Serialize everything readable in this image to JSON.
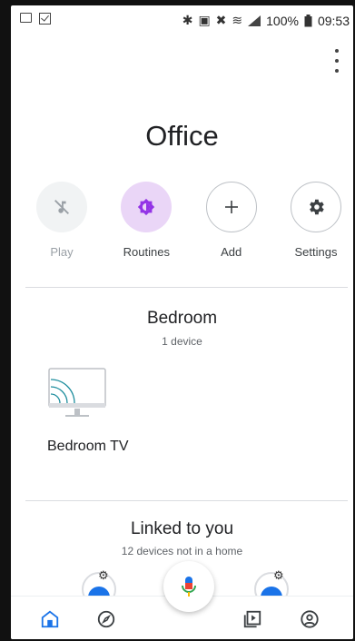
{
  "status_bar": {
    "battery": "100%",
    "time": "09:53",
    "icons": [
      "image-icon",
      "check-box-icon",
      "bluetooth-icon",
      "nfc-icon",
      "mute-icon",
      "wifi-icon",
      "signal-icon",
      "battery-icon"
    ]
  },
  "home": {
    "title": "Office"
  },
  "actions": [
    {
      "label": "Play",
      "icon": "play-disabled-icon",
      "state": "disabled"
    },
    {
      "label": "Routines",
      "icon": "routines-icon"
    },
    {
      "label": "Add",
      "icon": "plus-icon"
    },
    {
      "label": "Settings",
      "icon": "gear-icon"
    }
  ],
  "room": {
    "title": "Bedroom",
    "subtitle": "1 device",
    "device_name": "Bedroom TV",
    "device_icon": "cast-tv-icon"
  },
  "linked": {
    "title": "Linked to you",
    "subtitle": "12 devices not in a home"
  },
  "bottom_nav": [
    "home-icon",
    "explore-icon",
    "media-icon",
    "account-icon"
  ],
  "colors": {
    "accent": "#1a73e8",
    "routines_bg": "#ead6f7",
    "routines_icon": "#9334e6"
  }
}
